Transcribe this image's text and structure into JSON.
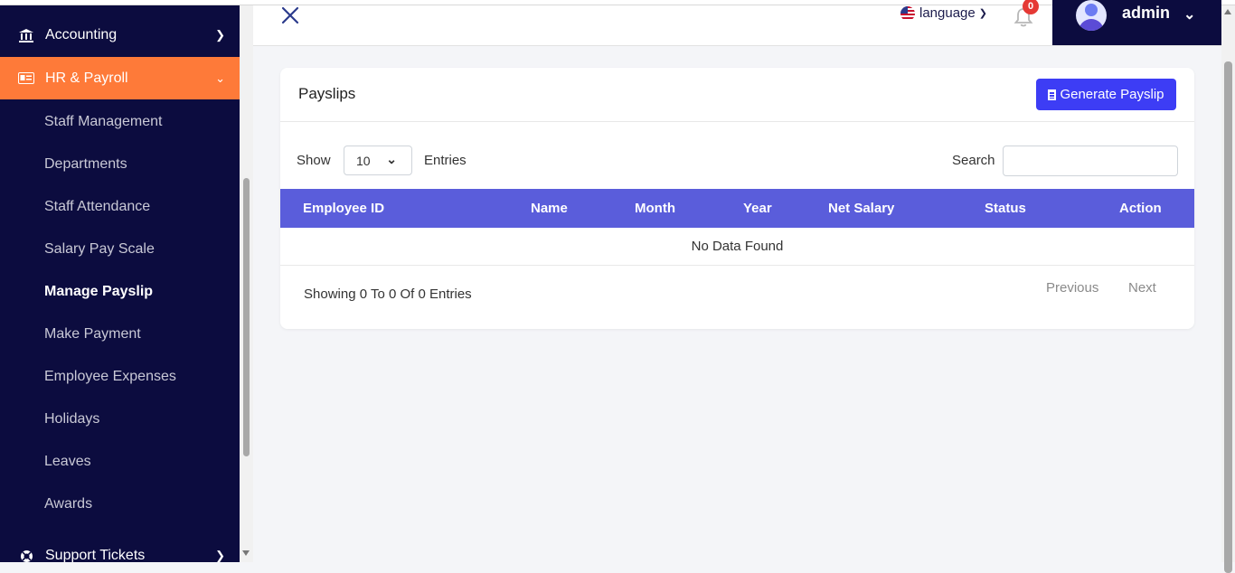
{
  "sidebar": {
    "accounting_label": "Accounting",
    "hr_label": "HR & Payroll",
    "hr_submenu": [
      "Staff Management",
      "Departments",
      "Staff Attendance",
      "Salary Pay Scale",
      "Manage Payslip",
      "Make Payment",
      "Employee Expenses",
      "Holidays",
      "Leaves",
      "Awards"
    ],
    "active_item": "Manage Payslip",
    "support_label": "Support Tickets",
    "accent_color": "#fe7a39",
    "bg_color": "#0c0c3f"
  },
  "header": {
    "language_label": "language",
    "notification_count": "0",
    "user_name": "admin"
  },
  "card": {
    "title": "Payslips",
    "generate_button": "Generate Payslip",
    "show_label": "Show",
    "entries_value": "10",
    "entries_label": "Entries",
    "search_label": "Search",
    "search_value": "",
    "columns": [
      "Employee ID",
      "Name",
      "Month",
      "Year",
      "Net Salary",
      "Status",
      "Action"
    ],
    "empty_message": "No Data Found",
    "showing_text": "Showing 0 To 0 Of 0 Entries",
    "prev_label": "Previous",
    "next_label": "Next",
    "header_color": "#5a5ddb",
    "button_color": "#3d3df5"
  }
}
